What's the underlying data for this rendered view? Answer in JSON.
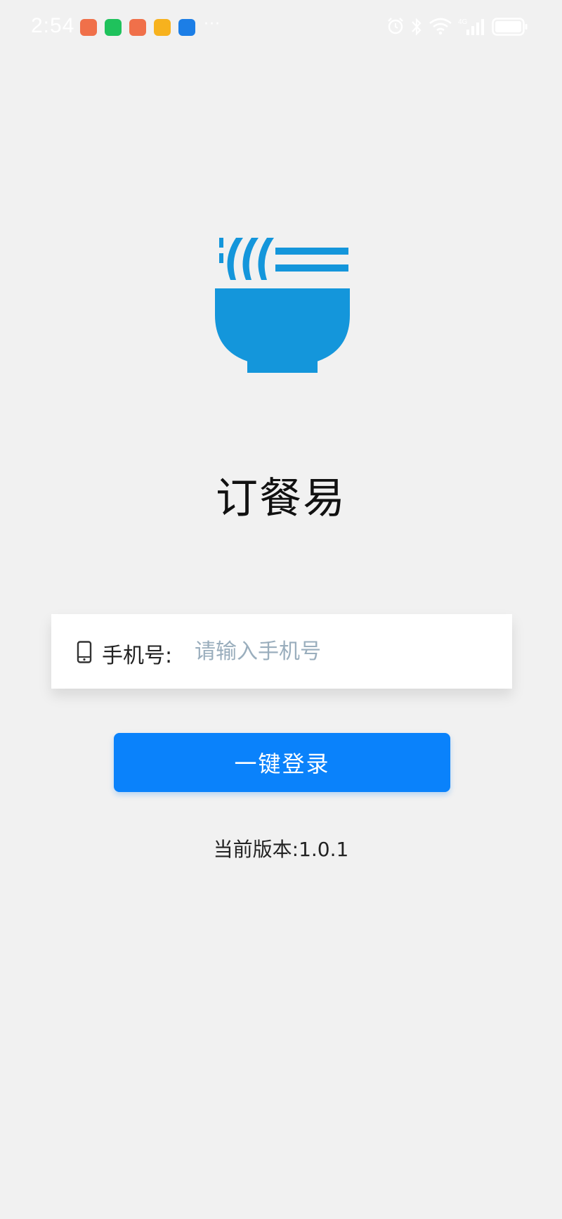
{
  "status_bar": {
    "time": "2:54",
    "overflow_indicator": "···",
    "icons": [
      "app-notification-icon",
      "wechat-icon",
      "app-notification-icon",
      "app-notification-icon",
      "weather-icon",
      "alarm-icon",
      "bluetooth-icon",
      "wifi-icon",
      "cellular-signal-icon",
      "battery-icon"
    ],
    "network_label": "4G"
  },
  "app": {
    "name": "订餐易",
    "logo_icon": "noodle-bowl-icon",
    "logo_color": "#1496db"
  },
  "login_form": {
    "phone_label": "手机号:",
    "phone_placeholder": "请输入手机号",
    "phone_icon": "mobile-phone-icon",
    "login_button_label": "一键登录",
    "button_color": "#0a82fb"
  },
  "footer": {
    "version_text": "当前版本:1.0.1"
  }
}
